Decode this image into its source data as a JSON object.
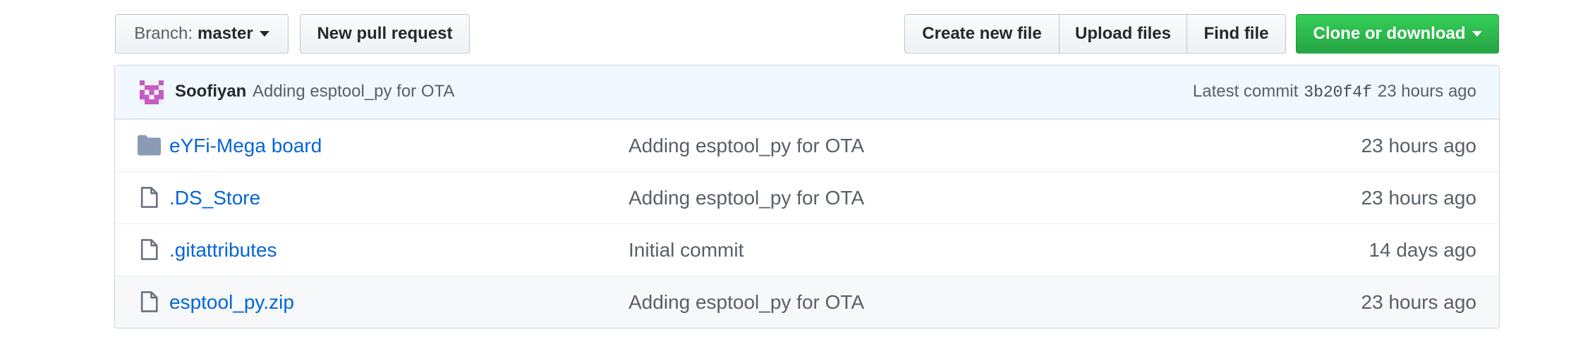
{
  "toolbar": {
    "branch_prefix": "Branch:",
    "branch_name": "master",
    "new_pr_label": "New pull request",
    "create_file_label": "Create new file",
    "upload_files_label": "Upload files",
    "find_file_label": "Find file",
    "clone_label": "Clone or download"
  },
  "commit": {
    "author": "Soofiyan",
    "message": "Adding esptool_py for OTA",
    "latest_label": "Latest commit",
    "sha": "3b20f4f",
    "age": "23 hours ago"
  },
  "files": [
    {
      "icon": "folder-icon",
      "name": "eYFi-Mega board",
      "message": "Adding esptool_py for OTA",
      "age": "23 hours ago"
    },
    {
      "icon": "file-icon",
      "name": ".DS_Store",
      "message": "Adding esptool_py for OTA",
      "age": "23 hours ago"
    },
    {
      "icon": "file-icon",
      "name": ".gitattributes",
      "message": "Initial commit",
      "age": "14 days ago"
    },
    {
      "icon": "file-icon",
      "name": "esptool_py.zip",
      "message": "Adding esptool_py for OTA",
      "age": "23 hours ago"
    }
  ],
  "colors": {
    "link": "#0366d6",
    "clone_button": "#28a745",
    "commit_bar": "#f1f8ff",
    "folder_icon": "#79b8ff",
    "avatar": "#c45cc4"
  }
}
